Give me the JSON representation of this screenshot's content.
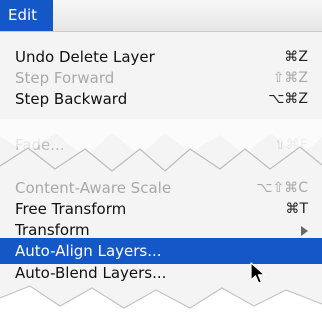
{
  "menubar": {
    "title": "Edit"
  },
  "menu": {
    "items": [
      {
        "label": "Undo Delete Layer",
        "shortcut": "⌘Z"
      },
      {
        "label": "Step Forward",
        "shortcut": "⇧⌘Z"
      },
      {
        "label": "Step Backward",
        "shortcut": "⌥⌘Z"
      },
      {
        "label": "Fade...",
        "shortcut": "⇧⌘F"
      },
      {
        "label": "Content-Aware Scale",
        "shortcut": "⌥⇧⌘C"
      },
      {
        "label": "Free Transform",
        "shortcut": "⌘T"
      },
      {
        "label": "Transform"
      },
      {
        "label": "Auto-Align Layers..."
      },
      {
        "label": "Auto-Blend Layers..."
      }
    ]
  },
  "colors": {
    "highlight": "#1458c7",
    "menu_bg": "#f4f4f4",
    "disabled_text": "#a9a9a9"
  },
  "icons": [
    "submenu-arrow-icon",
    "mouse-pointer-icon"
  ]
}
